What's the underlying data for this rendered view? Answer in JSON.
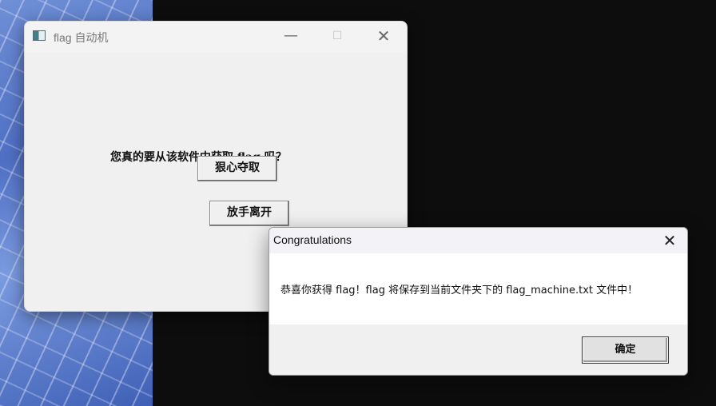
{
  "app_window": {
    "title": "flag 自动机",
    "controls": {
      "minimize": "—",
      "maximize": "☐",
      "close": "✕"
    },
    "question": "您真的要从该软件中获取 flag 吗？",
    "take_button": "狠心夺取",
    "leave_button": "放手离开"
  },
  "message_box": {
    "title": "Congratulations",
    "close": "✕",
    "message": "恭喜你获得 flag！flag 将保存到当前文件夹下的 flag_machine.txt 文件中！",
    "ok_button": "确定"
  }
}
